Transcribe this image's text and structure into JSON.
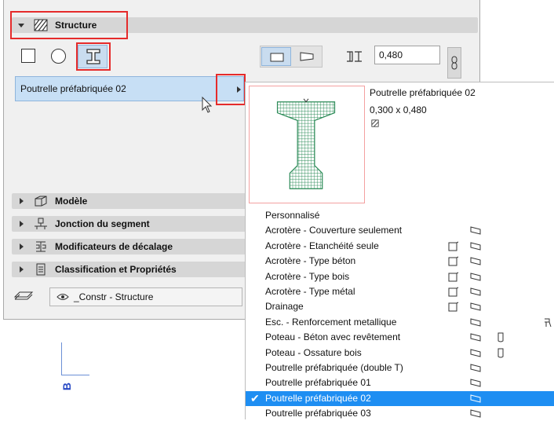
{
  "structure": {
    "title": "Structure",
    "profile_value": "Poutrelle préfabriquée 02",
    "height_value": "0,480"
  },
  "preview": {
    "name": "Poutrelle préfabriquée 02",
    "dimensions": "0,300 x 0,480"
  },
  "sections": [
    {
      "label": "Modèle",
      "icon": "model-icon"
    },
    {
      "label": "Jonction du segment",
      "icon": "segment-junction-icon"
    },
    {
      "label": "Modificateurs de décalage",
      "icon": "offset-modifier-icon"
    },
    {
      "label": "Classification et Propriétés",
      "icon": "classification-icon"
    }
  ],
  "layer": {
    "value": "_Constr - Structure"
  },
  "profile_list": [
    {
      "label": "Personnalisé",
      "selected": false
    },
    {
      "label": "Acrotère - Couverture seulement",
      "selected": false
    },
    {
      "label": "Acrotère - Etanchéité seule",
      "selected": false
    },
    {
      "label": "Acrotère - Type béton",
      "selected": false
    },
    {
      "label": "Acrotère - Type bois",
      "selected": false
    },
    {
      "label": "Acrotère - Type métal",
      "selected": false
    },
    {
      "label": "Drainage",
      "selected": false
    },
    {
      "label": "Esc. - Renforcement metallique",
      "selected": false
    },
    {
      "label": "Poteau - Béton avec revêtement",
      "selected": false
    },
    {
      "label": "Poteau - Ossature bois",
      "selected": false
    },
    {
      "label": "Poutrelle préfabriquée (double T)",
      "selected": false
    },
    {
      "label": "Poutrelle préfabriquée 01",
      "selected": false
    },
    {
      "label": "Poutrelle préfabriquée 02",
      "selected": true
    },
    {
      "label": "Poutrelle préfabriquée 03",
      "selected": false
    }
  ],
  "canvas": {
    "label": "B"
  },
  "colors": {
    "highlight": "#1e8ef2",
    "callout": "#e52b2b",
    "section_bar": "#d6d6d6",
    "hatch": "#2a8a56"
  }
}
